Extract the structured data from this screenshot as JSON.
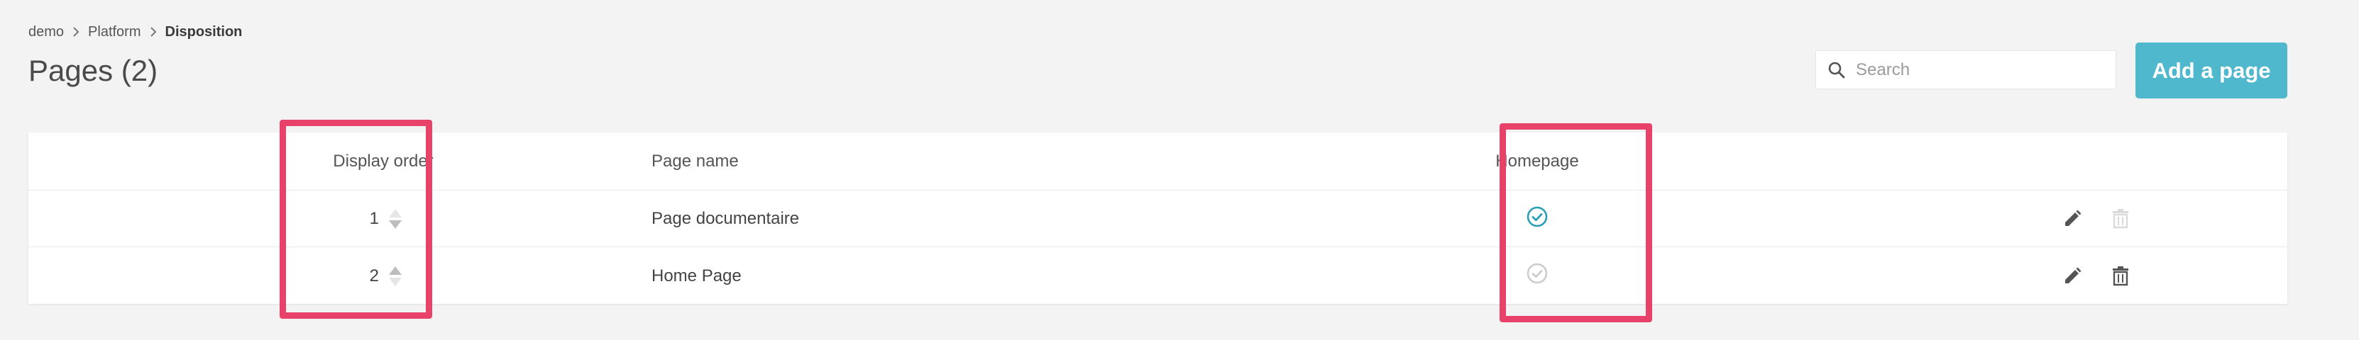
{
  "breadcrumb": [
    "demo",
    "Platform",
    "Disposition"
  ],
  "page": {
    "title": "Pages (2)"
  },
  "search": {
    "placeholder": "Search",
    "value": ""
  },
  "add_button": {
    "label": "Add a page",
    "color": "#4fb8cc"
  },
  "table": {
    "headers": {
      "display_order": "Display order",
      "page_name": "Page name",
      "homepage": "Homepage"
    },
    "rows": [
      {
        "order": "1",
        "name": "Page documentaire",
        "homepage": true
      },
      {
        "order": "2",
        "name": "Home Page",
        "homepage": false
      }
    ]
  },
  "icons": {
    "breadcrumb_separator": "chevron-right-icon",
    "search": "search-icon",
    "sort": "sort-arrows-icon",
    "homepage": "check-circle-icon",
    "edit": "pencil-icon",
    "delete": "trash-icon"
  },
  "colors": {
    "accent": "#4fb8cc",
    "homepage_active": "#2a9fb6",
    "homepage_inactive": "#cccccc",
    "highlight": "#e8426b"
  }
}
